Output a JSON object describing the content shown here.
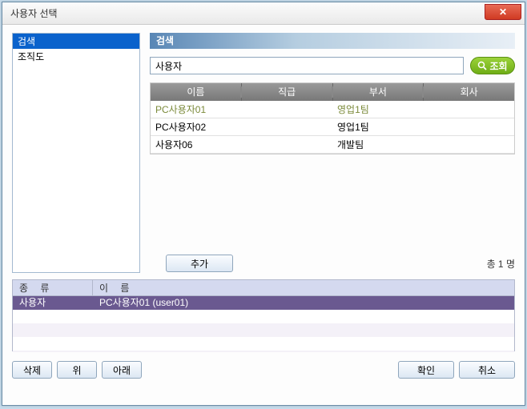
{
  "window": {
    "title": "사용자 선택",
    "close": "✕"
  },
  "sidebar": {
    "items": [
      {
        "label": "검색",
        "selected": true
      },
      {
        "label": "조직도",
        "selected": false
      }
    ]
  },
  "search": {
    "header": "검색",
    "value": "사용자",
    "button": "조회"
  },
  "table": {
    "headers": [
      "이름",
      "직급",
      "부서",
      "회사"
    ],
    "rows": [
      {
        "name": "PC사용자01",
        "rank": "",
        "dept": "영업1팀",
        "company": "",
        "selected": true
      },
      {
        "name": "PC사용자02",
        "rank": "",
        "dept": "영업1팀",
        "company": "",
        "selected": false
      },
      {
        "name": "사용자06",
        "rank": "",
        "dept": "개발팀",
        "company": "",
        "selected": false
      }
    ]
  },
  "addButton": "추가",
  "countText": "총 1 명",
  "grid": {
    "headers": {
      "type": "종 류",
      "name": "이 름"
    },
    "rows": [
      {
        "type": "사용자",
        "name": "PC사용자01 (user01)"
      }
    ]
  },
  "footer": {
    "delete": "삭제",
    "up": "위",
    "down": "아래",
    "ok": "확인",
    "cancel": "취소"
  }
}
